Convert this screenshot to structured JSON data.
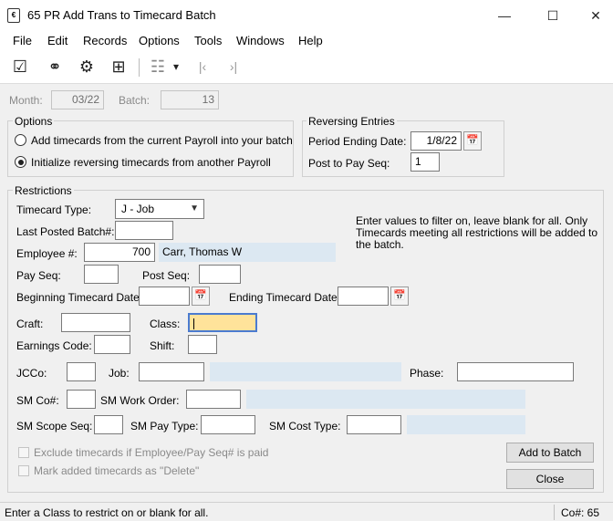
{
  "window": {
    "title": "65 PR Add Trans to Timecard Batch",
    "app_icon_text": "€",
    "minimize_glyph": "—",
    "maximize_glyph": "☐",
    "close_glyph": "✕"
  },
  "menu": [
    "File",
    "Edit",
    "Records",
    "Options",
    "Tools",
    "Windows",
    "Help"
  ],
  "toolbar": {
    "icons": [
      "edit-check-icon",
      "binoculars-icon",
      "settings-gear-icon",
      "calculator-icon",
      "grid-view-icon",
      "dropdown-arrow-icon",
      "first-record-icon",
      "last-record-icon"
    ],
    "glyphs": [
      "☑",
      "⚭",
      "⚙",
      "⊞",
      "☷",
      "▾",
      "|‹",
      "›|"
    ]
  },
  "header": {
    "month_label": "Month:",
    "month_value": "03/22",
    "batch_label": "Batch:",
    "batch_value": "13"
  },
  "options": {
    "title": "Options",
    "radio1": "Add timecards from the current Payroll into your batch",
    "radio2": "Initialize reversing timecards from another Payroll",
    "selected": 2
  },
  "reversing": {
    "title": "Reversing Entries",
    "period_label": "Period Ending Date:",
    "period_value": "1/8/22",
    "post_label": "Post to Pay Seq:",
    "post_value": "1"
  },
  "restrictions": {
    "title": "Restrictions",
    "timecard_type_label": "Timecard Type:",
    "timecard_type_value": "J - Job",
    "last_posted_label": "Last Posted Batch#:",
    "last_posted_value": "",
    "employee_label": "Employee #:",
    "employee_value": "700",
    "employee_name": "Carr, Thomas W",
    "hint": "Enter values to filter on, leave blank for all. Only Timecards meeting all restrictions will be added to the batch.",
    "pay_seq_label": "Pay Seq:",
    "post_seq_label": "Post Seq:",
    "begin_date_label": "Beginning Timecard Date:",
    "end_date_label": "Ending Timecard Date:",
    "craft_label": "Craft:",
    "class_label": "Class:",
    "earnings_label": "Earnings Code:",
    "shift_label": "Shift:",
    "jcco_label": "JCCo:",
    "job_label": "Job:",
    "phase_label": "Phase:",
    "smco_label": "SM Co#:",
    "sm_work_order_label": "SM Work Order:",
    "sm_scope_label": "SM Scope Seq:",
    "sm_pay_type_label": "SM Pay Type:",
    "sm_cost_type_label": "SM Cost Type:"
  },
  "checks": {
    "exclude": "Exclude timecards if Employee/Pay Seq# is paid",
    "mark_deleted": "Mark added timecards as \"Delete\""
  },
  "buttons": {
    "add": "Add to Batch",
    "close": "Close"
  },
  "status": {
    "message": "Enter a Class to restrict on or blank for all.",
    "company": "Co#: 65"
  },
  "colors": {
    "focus_fill": "#ffe39a",
    "readonly_fill": "#dce8f2"
  }
}
